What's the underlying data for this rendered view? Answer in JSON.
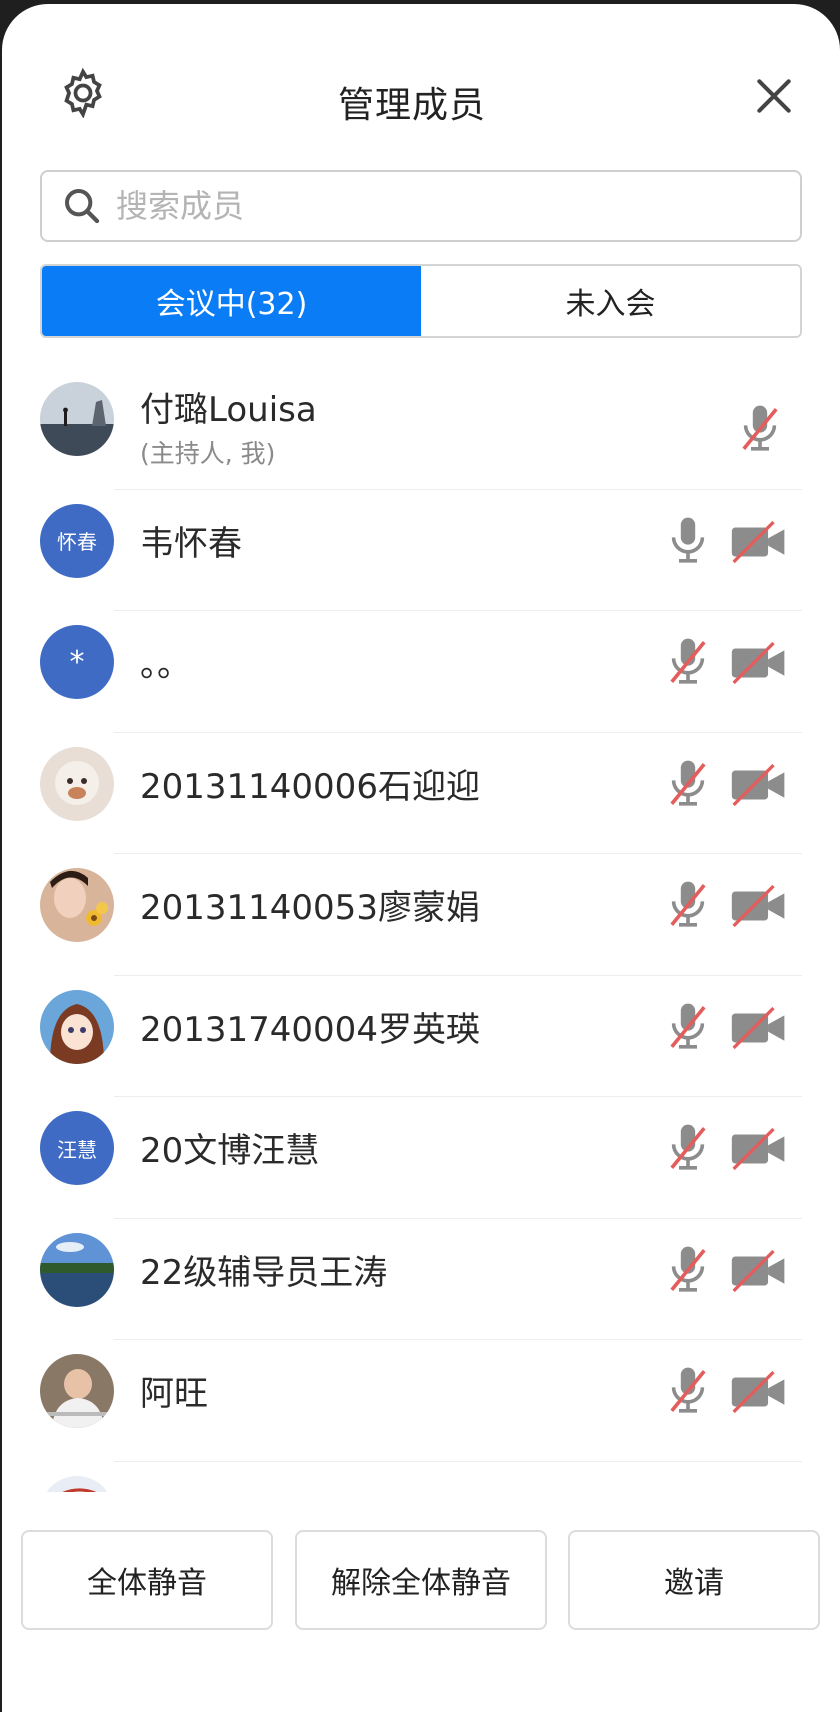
{
  "header": {
    "title": "管理成员"
  },
  "search": {
    "placeholder": "搜索成员"
  },
  "tabs": [
    {
      "label": "会议中(32)",
      "active": true
    },
    {
      "label": "未入会",
      "active": false
    }
  ],
  "members": [
    {
      "name": "付璐Louisa",
      "subtitle": "(主持人, 我)",
      "avatar": "photo-seaside",
      "mic": "muted",
      "cam": "none"
    },
    {
      "name": "韦怀春",
      "avatar_text": "怀春",
      "mic": "on",
      "cam": "off"
    },
    {
      "name": "。。",
      "avatar_text": "*",
      "mic": "muted",
      "cam": "off"
    },
    {
      "name": "20131140006石迎迎",
      "avatar": "photo-sheep",
      "mic": "muted",
      "cam": "off"
    },
    {
      "name": "20131140053廖蒙娟",
      "avatar": "photo-flower",
      "mic": "muted",
      "cam": "off"
    },
    {
      "name": "20131740004罗英瑛",
      "avatar": "photo-anime",
      "mic": "muted",
      "cam": "off"
    },
    {
      "name": "20文博汪慧",
      "avatar_text": "汪慧",
      "mic": "muted",
      "cam": "off"
    },
    {
      "name": "22级辅导员王涛",
      "avatar": "photo-lake",
      "mic": "muted",
      "cam": "off"
    },
    {
      "name": "阿旺",
      "avatar": "photo-person",
      "mic": "muted",
      "cam": "off"
    }
  ],
  "footer": {
    "mute_all": "全体静音",
    "unmute_all": "解除全体静音",
    "invite": "邀请"
  },
  "colors": {
    "accent": "#0a7cf5",
    "avatar_bg": "#3f6bc4",
    "muted_slash": "#e35d5d",
    "icon_gray": "#8c8c8c"
  }
}
